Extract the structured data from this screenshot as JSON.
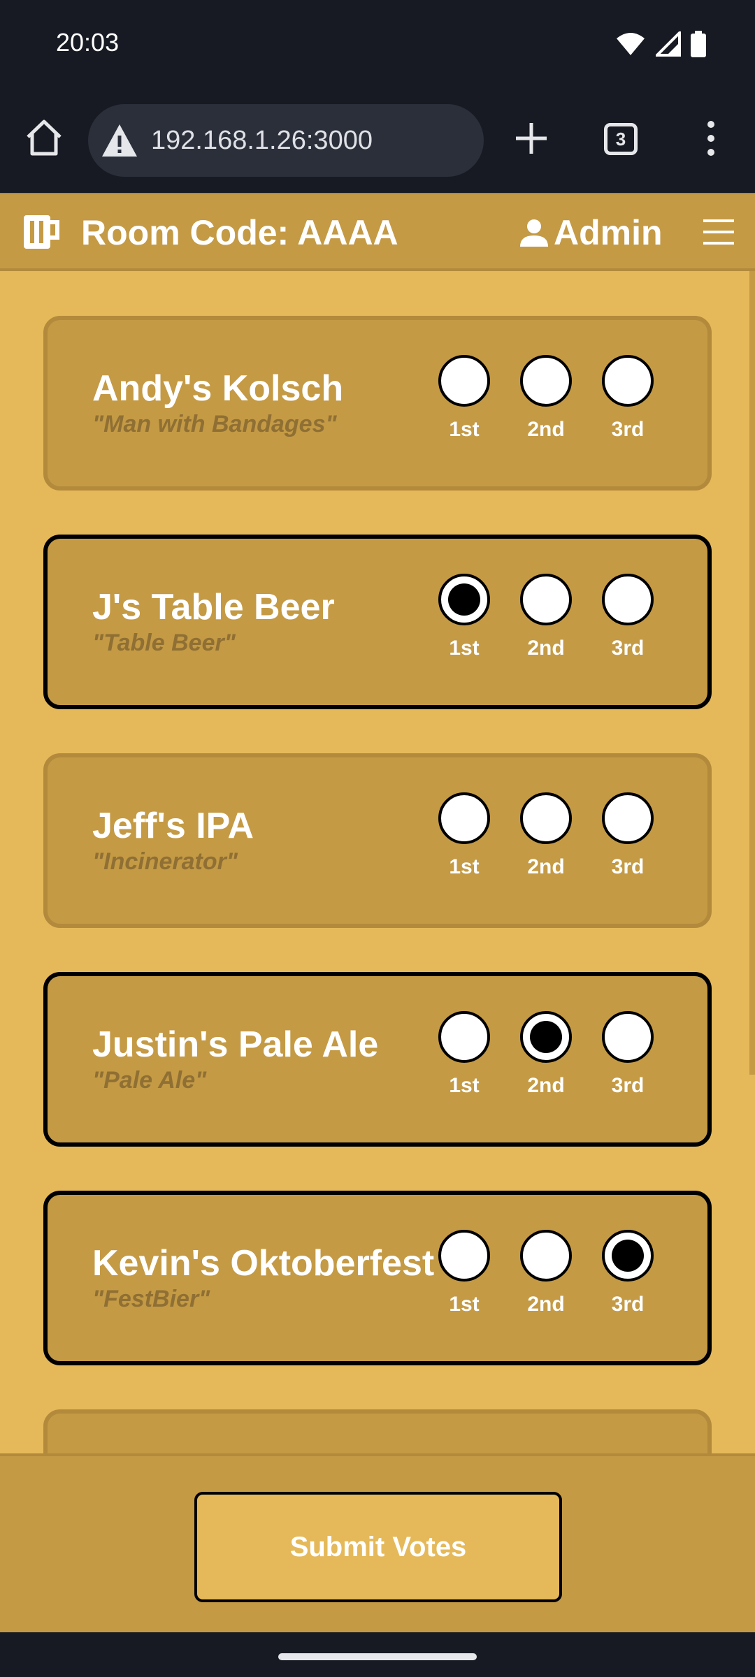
{
  "status": {
    "time": "20:03"
  },
  "browser": {
    "url": "192.168.1.26:3000",
    "tab_count": "3"
  },
  "header": {
    "room_code": "Room Code: AAAA",
    "user": "Admin"
  },
  "rank_labels": [
    "1st",
    "2nd",
    "3rd"
  ],
  "beers": [
    {
      "name": "Andy's Kolsch",
      "subtitle": "\"Man with Bandages\"",
      "selected": null
    },
    {
      "name": "J's Table Beer",
      "subtitle": "\"Table Beer\"",
      "selected": 0
    },
    {
      "name": "Jeff's IPA",
      "subtitle": "\"Incinerator\"",
      "selected": null
    },
    {
      "name": "Justin's Pale Ale",
      "subtitle": "\"Pale Ale\"",
      "selected": 1
    },
    {
      "name": "Kevin's Oktoberfest",
      "subtitle": "\"FestBier\"",
      "selected": 2
    },
    {
      "name": "",
      "subtitle": "",
      "selected": null
    }
  ],
  "footer": {
    "submit_label": "Submit Votes"
  }
}
